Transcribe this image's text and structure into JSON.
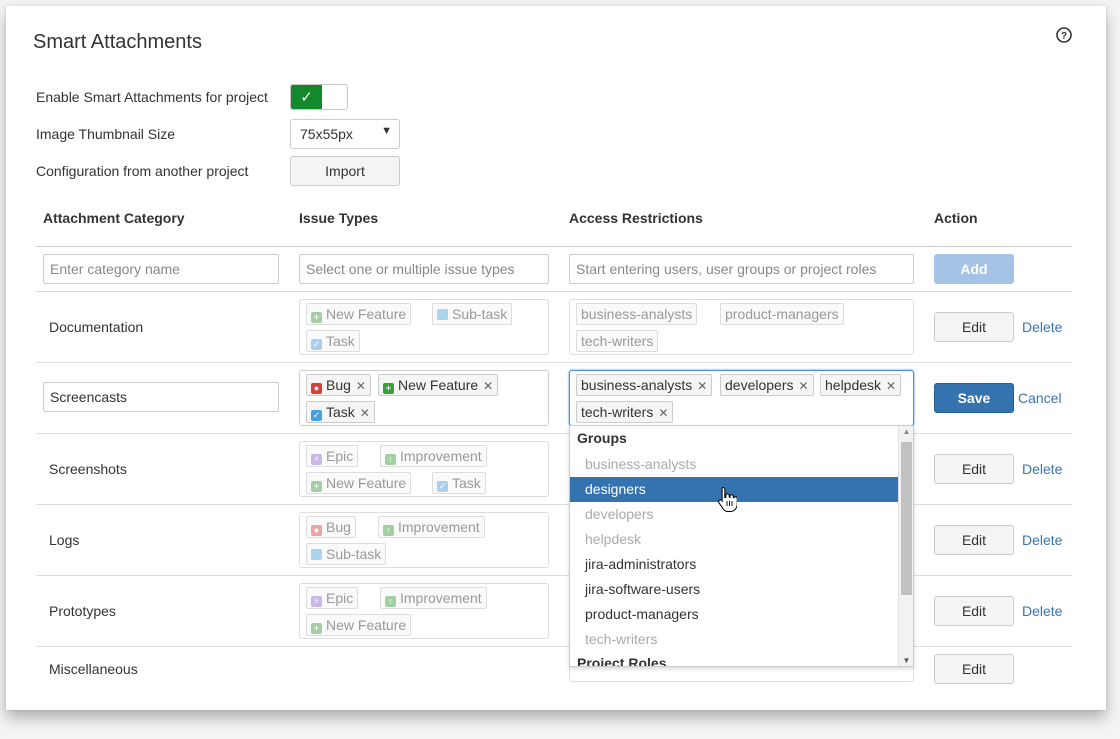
{
  "title": "Smart Attachments",
  "config": {
    "enable_label": "Enable Smart Attachments for project",
    "toggle_check": "✓",
    "thumb_label": "Image Thumbnail Size",
    "thumb_value": "75x55px",
    "import_label": "Configuration from another project",
    "import_button": "Import"
  },
  "table": {
    "headers": [
      "Attachment Category",
      "Issue Types",
      "Access Restrictions",
      "Action"
    ],
    "new_row": {
      "category_placeholder": "Enter category name",
      "issue_placeholder": "Select one or multiple issue types",
      "access_placeholder": "Start entering users, user groups or project roles",
      "add_button": "Add"
    },
    "rows": [
      {
        "category": "Documentation",
        "issue_types": [
          "New Feature",
          "Sub-task",
          "Task"
        ],
        "access": [
          "business-analysts",
          "product-managers",
          "tech-writers"
        ],
        "edit": "Edit",
        "delete": "Delete"
      },
      {
        "category": "Screencasts",
        "issue_types": [
          "Bug",
          "New Feature",
          "Task"
        ],
        "access": [
          "business-analysts",
          "developers",
          "helpdesk",
          "tech-writers"
        ],
        "save": "Save",
        "cancel": "Cancel"
      },
      {
        "category": "Screenshots",
        "issue_types": [
          "Epic",
          "Improvement",
          "New Feature",
          "Task"
        ],
        "edit": "Edit",
        "delete": "Delete"
      },
      {
        "category": "Logs",
        "issue_types": [
          "Bug",
          "Improvement",
          "Sub-task"
        ],
        "edit": "Edit",
        "delete": "Delete"
      },
      {
        "category": "Prototypes",
        "issue_types": [
          "Epic",
          "Improvement",
          "New Feature"
        ],
        "edit": "Edit",
        "delete": "Delete"
      },
      {
        "category": "Miscellaneous",
        "edit": "Edit"
      }
    ]
  },
  "dropdown": {
    "groups_header": "Groups",
    "items": [
      "business-analysts",
      "designers",
      "developers",
      "helpdesk",
      "jira-administrators",
      "jira-software-users",
      "product-managers",
      "tech-writers"
    ],
    "roles_header": "Project Roles"
  },
  "colors": {
    "toggle_on": "#14892c",
    "primary": "#3572b0",
    "link": "#3b73af"
  }
}
